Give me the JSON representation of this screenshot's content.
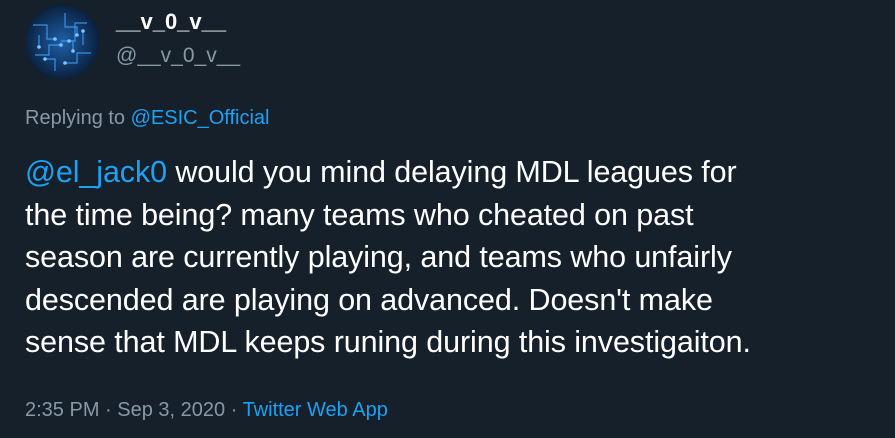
{
  "tweet": {
    "display_name": "__v_0_v__",
    "handle": "@__v_0_v__",
    "replying_prefix": "Replying to",
    "replying_to": "@ESIC_Official",
    "mention": "@el_jack0",
    "body_lines": [
      " would you mind delaying MDL leagues for",
      "the time being? many teams who cheated on past",
      "season are currently playing, and teams who unfairly",
      "descended are playing on advanced. Doesn't make",
      "sense that MDL keeps runing during this investigaiton."
    ],
    "time": "2:35 PM",
    "separator": " · ",
    "date": "Sep 3, 2020",
    "source": "Twitter Web App"
  },
  "colors": {
    "background": "#15202b",
    "text_primary": "#ffffff",
    "text_secondary": "#8899a6",
    "link": "#1da1f2"
  },
  "icons": {
    "avatar": "circuit-board-avatar"
  }
}
